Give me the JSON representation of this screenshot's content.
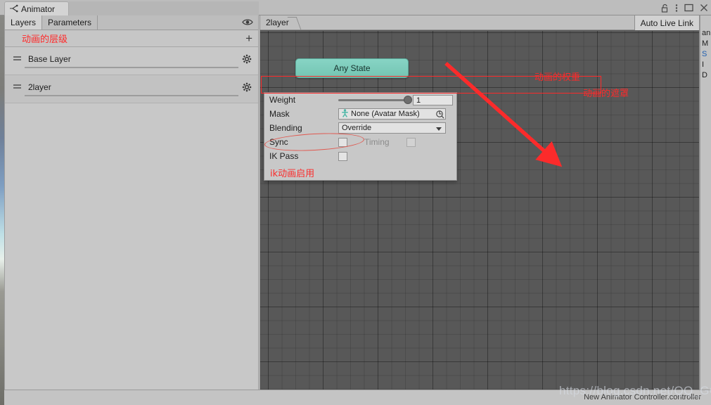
{
  "window": {
    "controls": [
      {
        "name": "lock-icon",
        "glyph": "lock"
      },
      {
        "name": "kebab-menu-icon",
        "glyph": "kebab"
      },
      {
        "name": "maximize-icon",
        "glyph": "maximize"
      },
      {
        "name": "close-icon",
        "glyph": "close"
      }
    ]
  },
  "tab": {
    "label": "Animator",
    "icon": "animator-node-icon"
  },
  "layers_panel": {
    "tabs": [
      {
        "label": "Layers",
        "active": true
      },
      {
        "label": "Parameters",
        "active": false
      }
    ],
    "eye_icon": "visibility-eye-icon",
    "header_note": "动画的层级",
    "add_label": "+",
    "layers": [
      {
        "name": "Base Layer",
        "gear": "settings-gear-icon"
      },
      {
        "name": "2layer",
        "gear": "settings-gear-icon"
      }
    ]
  },
  "graph": {
    "breadcrumb": "2layer",
    "live_link_label": "Auto Live Link",
    "nodes": [
      {
        "label": "Any State",
        "color": "#7ccbba"
      }
    ]
  },
  "settings_popover": {
    "weight": {
      "label": "Weight",
      "value": "1",
      "slider_percent": 100
    },
    "mask": {
      "label": "Mask",
      "value": "None (Avatar Mask)",
      "icon": "avatar-mask-icon",
      "picker_icon": "object-picker-icon"
    },
    "blending": {
      "label": "Blending",
      "value": "Override",
      "arrow_icon": "chevron-down-icon"
    },
    "sync": {
      "label": "Sync",
      "checked": false,
      "timing_label": "Timing",
      "timing_checked": false,
      "timing_disabled": true
    },
    "ik_pass": {
      "label": "IK Pass",
      "checked": false
    }
  },
  "annotations": {
    "weight_note": "动画的权重",
    "mask_note": "动画的遮罩",
    "ik_note": "ik动画启用"
  },
  "status": {
    "controller_text": "New Animator Controller.controller",
    "watermark": "https://blog.csdn.net/QQ_GO"
  },
  "right_sliver": {
    "lines": [
      "an",
      "M",
      "S",
      "I",
      "D"
    ]
  },
  "colors": {
    "node_teal": "#7ccbba",
    "annotation_red": "#fb2b2b",
    "panel_grey": "#c8c8c8",
    "canvas_grey": "#585858"
  }
}
